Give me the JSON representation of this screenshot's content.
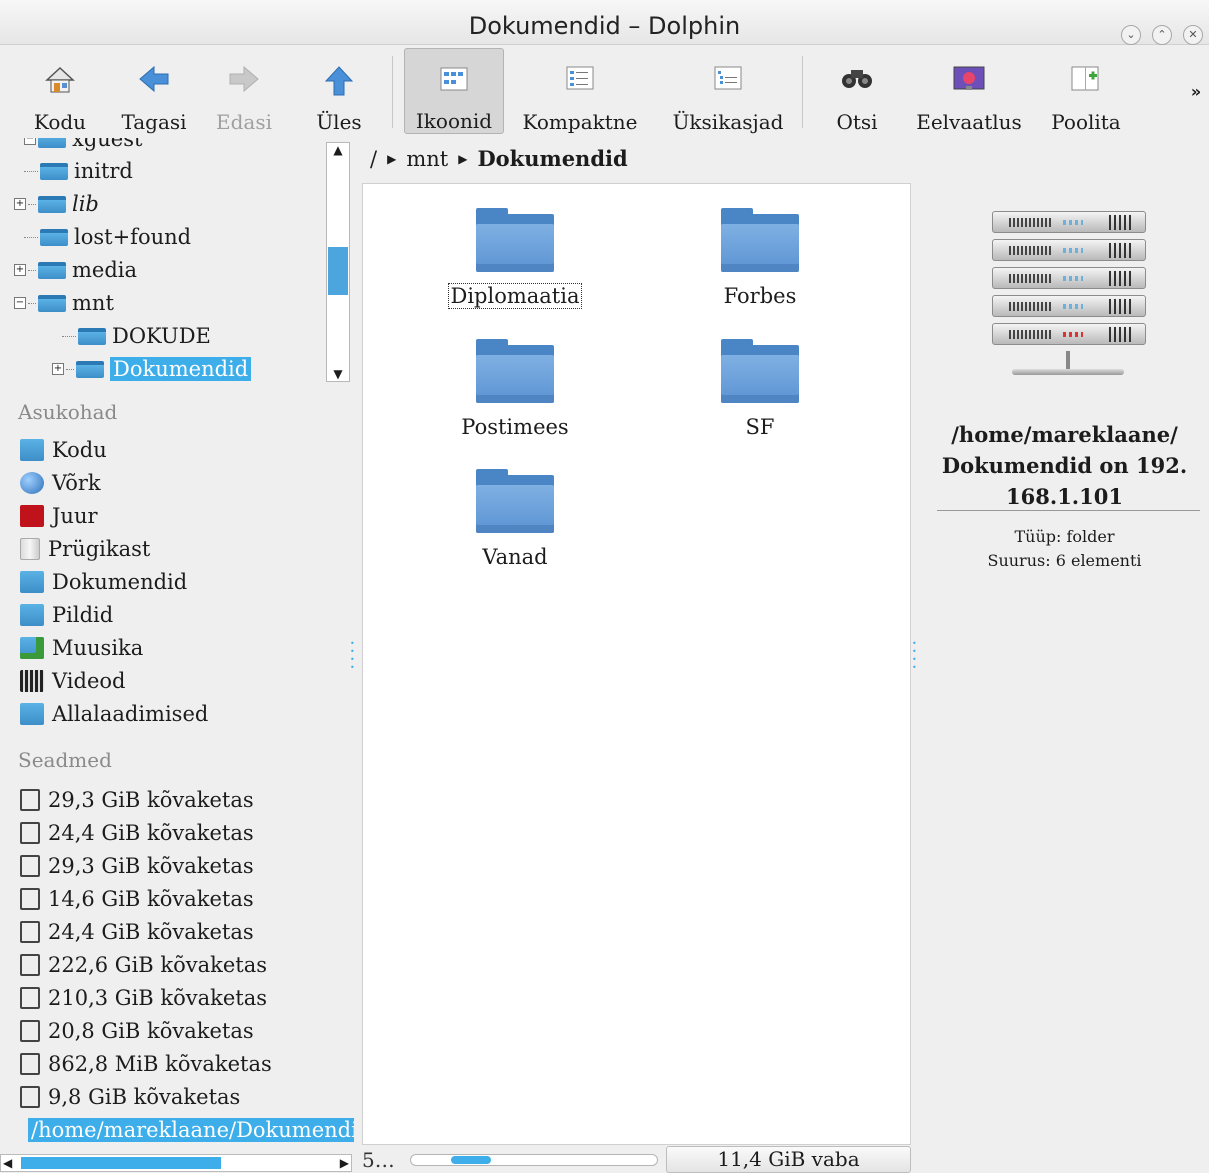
{
  "window": {
    "title": "Dokumendid – Dolphin",
    "controls": [
      "minimize",
      "maximize",
      "close"
    ]
  },
  "toolbar": {
    "home_label": "Kodu",
    "back_label": "Tagasi",
    "forward_label": "Edasi",
    "up_label": "Üles",
    "icons_label": "Ikoonid",
    "compact_label": "Kompaktne",
    "details_label": "Üksikasjad",
    "search_label": "Otsi",
    "preview_label": "Eelvaatlus",
    "split_label": "Poolita",
    "more_label": "»"
  },
  "tree": {
    "items": [
      {
        "label": "xguest",
        "icon": "folder-icon"
      },
      {
        "label": "initrd",
        "icon": "folder-icon"
      },
      {
        "label": "lib",
        "icon": "folder-link-icon"
      },
      {
        "label": "lost+found",
        "icon": "folder-icon"
      },
      {
        "label": "media",
        "icon": "folder-icon"
      },
      {
        "label": "mnt",
        "icon": "folder-icon"
      },
      {
        "label": "DOKUDE",
        "icon": "folder-icon"
      },
      {
        "label": "Dokumendid",
        "icon": "folder-icon",
        "selected": true
      }
    ]
  },
  "places": {
    "header": "Asukohad",
    "items": [
      {
        "label": "Kodu",
        "icon": "home-folder-icon"
      },
      {
        "label": "Võrk",
        "icon": "globe-icon"
      },
      {
        "label": "Juur",
        "icon": "root-folder-icon"
      },
      {
        "label": "Prügikast",
        "icon": "trash-icon"
      },
      {
        "label": "Dokumendid",
        "icon": "folder-icon"
      },
      {
        "label": "Pildid",
        "icon": "folder-icon"
      },
      {
        "label": "Muusika",
        "icon": "music-folder-icon"
      },
      {
        "label": "Videod",
        "icon": "video-folder-icon"
      },
      {
        "label": "Allalaadimised",
        "icon": "download-folder-icon"
      }
    ]
  },
  "devices": {
    "header": "Seadmed",
    "items": [
      {
        "label": "29,3 GiB kõvaketas"
      },
      {
        "label": "24,4 GiB kõvaketas"
      },
      {
        "label": "29,3 GiB kõvaketas"
      },
      {
        "label": "14,6 GiB kõvaketas"
      },
      {
        "label": "24,4 GiB kõvaketas"
      },
      {
        "label": "222,6 GiB kõvaketas"
      },
      {
        "label": "210,3 GiB kõvaketas"
      },
      {
        "label": "20,8 GiB kõvaketas"
      },
      {
        "label": "862,8 MiB kõvaketas"
      },
      {
        "label": "9,8 GiB kõvaketas"
      },
      {
        "label": "/home/mareklaane/Dokumendid",
        "selected": true
      }
    ]
  },
  "breadcrumb": {
    "root": "/",
    "parts": [
      "mnt",
      "Dokumendid"
    ]
  },
  "files": [
    {
      "name": "Diplomaatia",
      "focused": true
    },
    {
      "name": "Forbes"
    },
    {
      "name": "Postimees"
    },
    {
      "name": "SF"
    },
    {
      "name": "Vanad"
    }
  ],
  "statusbar": {
    "text": "5…",
    "free_space": "11,4 GiB vaba"
  },
  "info_panel": {
    "path": "/home/mareklaane/ Dokumendid on 192. 168.1.101",
    "path_lines": [
      "/home/mareklaane/",
      "Dokumendid on 192.",
      "168.1.101"
    ],
    "type_label": "Tüüp:",
    "type_value": "folder",
    "size_label": "Suurus:",
    "size_value": "6 elementi"
  },
  "colors": {
    "selection": "#3daee9",
    "folder": "#5b93d2"
  }
}
